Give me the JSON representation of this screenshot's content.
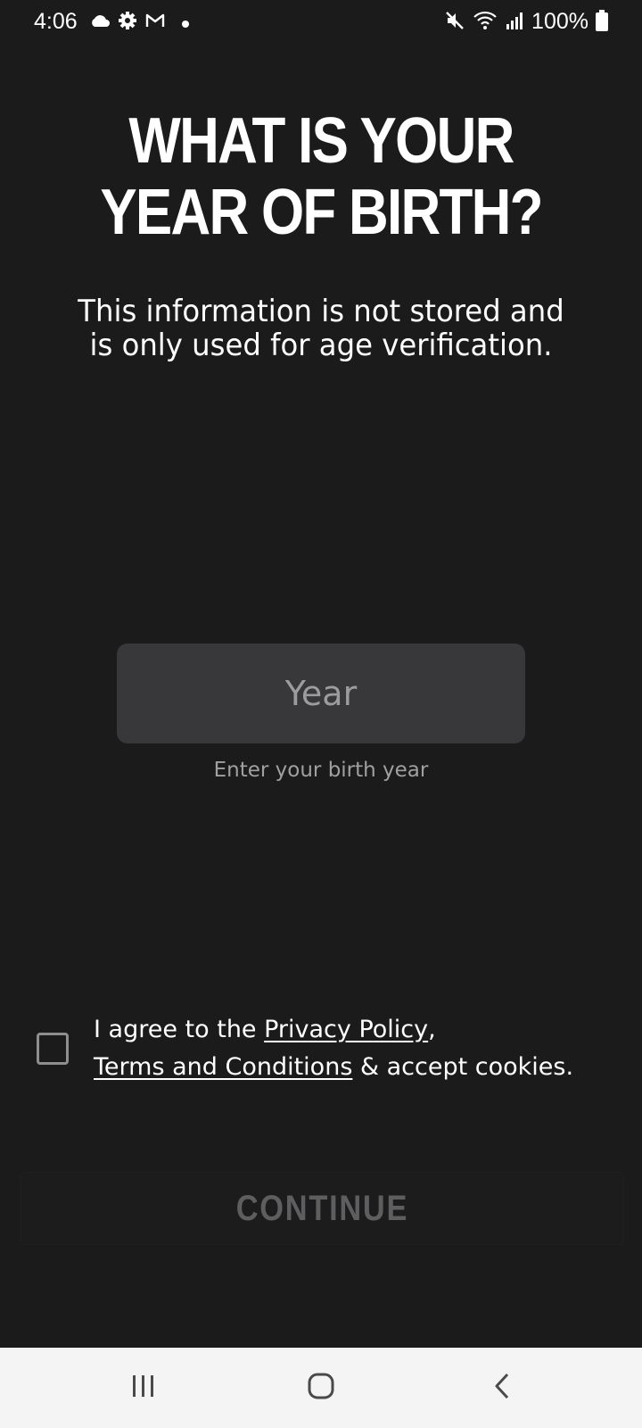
{
  "status_bar": {
    "time": "4:06",
    "left_icons": [
      "cloud-icon",
      "gear-icon",
      "gmail-icon",
      "dot-icon"
    ],
    "right_icons": [
      "mute-icon",
      "wifi-icon",
      "signal-icon",
      "battery-icon"
    ],
    "battery": "100%"
  },
  "heading": {
    "line1": "WHAT IS YOUR",
    "line2": "YEAR OF BIRTH?"
  },
  "subtitle": {
    "line1": "This information is not stored and",
    "line2": "is only used for age verification."
  },
  "year_field": {
    "value": "",
    "placeholder": "Year",
    "helper": "Enter your birth year"
  },
  "agreement": {
    "checked": false,
    "prefix": "I agree to the ",
    "privacy_link": "Privacy Policy",
    "comma": ",",
    "terms_link": "Terms and Conditions",
    "suffix": " & accept cookies."
  },
  "continue_button": {
    "label": "CONTINUE"
  },
  "nav_bar": {
    "buttons": [
      "recent-apps-icon",
      "home-icon",
      "back-icon"
    ]
  },
  "colors": {
    "background": "#1b1b1c",
    "input_background": "#38383a",
    "disabled_text": "#5e5e60",
    "nav_background": "#f4f4f5"
  }
}
